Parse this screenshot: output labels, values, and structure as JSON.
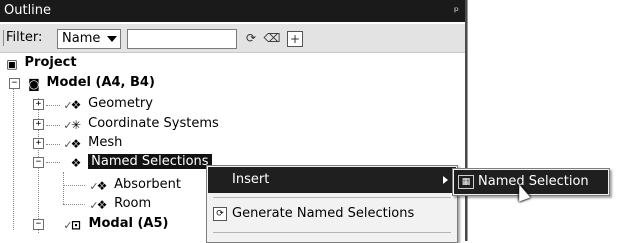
{
  "panel": {
    "title": "Outline",
    "pin_icon": "pin-icon"
  },
  "filter": {
    "label": "Filter:",
    "dropdown_value": "Name",
    "input_value": ""
  },
  "tree": {
    "project": "Project",
    "model": "Model (A4, B4)",
    "geometry": "Geometry",
    "coordinate_systems": "Coordinate Systems",
    "mesh": "Mesh",
    "named_selections": "Named Selections",
    "absorbent": "Absorbent",
    "room": "Room",
    "modal": "Modal (A5)"
  },
  "context_menu": {
    "insert": "Insert",
    "generate": "Generate Named Selections"
  },
  "submenu": {
    "named_selection": "Named Selection"
  },
  "colors": {
    "titlebar": "#1a1a1a",
    "selection": "#111111",
    "menu_highlight": "#1f1f1f"
  }
}
